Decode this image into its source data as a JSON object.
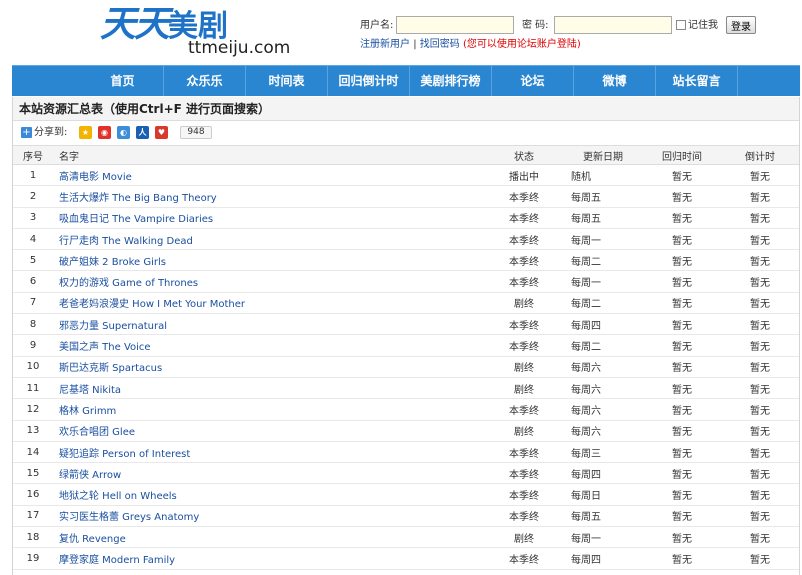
{
  "logo": {
    "cn_part1": "天天",
    "cn_part2": "美剧",
    "en": "ttmeiju.com"
  },
  "login": {
    "username_label": "用户名:",
    "username_value": "",
    "password_label": "密  码:",
    "password_value": "",
    "remember_label": "记住我",
    "login_button": "登录",
    "register_link": "注册新用户",
    "separator": "|",
    "forgot_link": "找回密码",
    "hint": "(您可以使用论坛账户登陆)"
  },
  "nav": [
    "首页",
    "众乐乐",
    "时间表",
    "回归倒计时",
    "美剧排行榜",
    "论坛",
    "微博",
    "站长留言"
  ],
  "panel": {
    "title": "本站资源汇总表（使用Ctrl+F 进行页面搜索）",
    "share_label": "分享到:",
    "share_count": "948",
    "share_icons": [
      "qzone-icon",
      "sina-weibo-icon",
      "tencent-weibo-icon",
      "renren-icon",
      "kaixin-icon"
    ]
  },
  "table": {
    "headers": [
      "序号",
      "名字",
      "状态",
      "更新日期",
      "回归时间",
      "倒计时"
    ],
    "rows": [
      [
        "1",
        "高清电影 Movie",
        "播出中",
        "随机",
        "暂无",
        "暂无"
      ],
      [
        "2",
        "生活大爆炸 The Big Bang Theory",
        "本季终",
        "每周五",
        "暂无",
        "暂无"
      ],
      [
        "3",
        "吸血鬼日记 The Vampire Diaries",
        "本季终",
        "每周五",
        "暂无",
        "暂无"
      ],
      [
        "4",
        "行尸走肉 The Walking Dead",
        "本季终",
        "每周一",
        "暂无",
        "暂无"
      ],
      [
        "5",
        "破产姐妹 2 Broke Girls",
        "本季终",
        "每周二",
        "暂无",
        "暂无"
      ],
      [
        "6",
        "权力的游戏 Game of Thrones",
        "本季终",
        "每周一",
        "暂无",
        "暂无"
      ],
      [
        "7",
        "老爸老妈浪漫史 How I Met Your Mother",
        "剧终",
        "每周二",
        "暂无",
        "暂无"
      ],
      [
        "8",
        "邪恶力量 Supernatural",
        "本季终",
        "每周四",
        "暂无",
        "暂无"
      ],
      [
        "9",
        "美国之声 The Voice",
        "本季终",
        "每周二",
        "暂无",
        "暂无"
      ],
      [
        "10",
        "斯巴达克斯 Spartacus",
        "剧终",
        "每周六",
        "暂无",
        "暂无"
      ],
      [
        "11",
        "尼基塔 Nikita",
        "剧终",
        "每周六",
        "暂无",
        "暂无"
      ],
      [
        "12",
        "格林 Grimm",
        "本季终",
        "每周六",
        "暂无",
        "暂无"
      ],
      [
        "13",
        "欢乐合唱团 Glee",
        "剧终",
        "每周六",
        "暂无",
        "暂无"
      ],
      [
        "14",
        "疑犯追踪 Person of Interest",
        "本季终",
        "每周三",
        "暂无",
        "暂无"
      ],
      [
        "15",
        "绿箭侠 Arrow",
        "本季终",
        "每周四",
        "暂无",
        "暂无"
      ],
      [
        "16",
        "地狱之轮 Hell on Wheels",
        "本季终",
        "每周日",
        "暂无",
        "暂无"
      ],
      [
        "17",
        "实习医生格蕾 Greys Anatomy",
        "本季终",
        "每周五",
        "暂无",
        "暂无"
      ],
      [
        "18",
        "复仇 Revenge",
        "剧终",
        "每周一",
        "暂无",
        "暂无"
      ],
      [
        "19",
        "摩登家庭 Modern Family",
        "本季终",
        "每周四",
        "暂无",
        "暂无"
      ]
    ]
  },
  "colors": {
    "nav_bg": "#2a86d1",
    "link": "#1a4fa0",
    "hint": "#dd0000",
    "logo": "#1e73c8"
  }
}
